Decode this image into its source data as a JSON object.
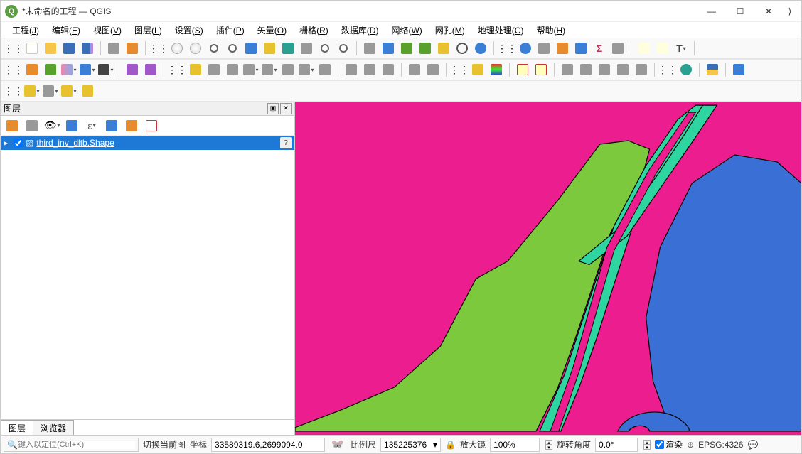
{
  "window": {
    "title": "*未命名的工程 — QGIS",
    "qicon_text": "Q"
  },
  "menu": [
    {
      "label": "工程",
      "key": "J"
    },
    {
      "label": "编辑",
      "key": "E"
    },
    {
      "label": "视图",
      "key": "V"
    },
    {
      "label": "图层",
      "key": "L"
    },
    {
      "label": "设置",
      "key": "S"
    },
    {
      "label": "插件",
      "key": "P"
    },
    {
      "label": "矢量",
      "key": "O"
    },
    {
      "label": "栅格",
      "key": "R"
    },
    {
      "label": "数据库",
      "key": "D"
    },
    {
      "label": "网络",
      "key": "W"
    },
    {
      "label": "网孔",
      "key": "M"
    },
    {
      "label": "地理处理",
      "key": "C"
    },
    {
      "label": "帮助",
      "key": "H"
    }
  ],
  "layers_panel": {
    "title": "图层",
    "layer_name": "third_inv_dltb.Shape"
  },
  "bottom_tabs": {
    "left": "图层",
    "right": "浏览器"
  },
  "statusbar": {
    "locator_placeholder": "键入以定位(Ctrl+K)",
    "toggle_label": "切换当前图",
    "coord_label": "坐标",
    "coord_value": "33589319.6,2699094.0",
    "scale_label": "比例尺",
    "scale_value": "135225376",
    "magnifier_label": "放大镜",
    "magnifier_value": "100%",
    "rotation_label": "旋转角度",
    "rotation_value": "0.0°",
    "render_label": "渲染",
    "crs_label": "EPSG:4326"
  }
}
